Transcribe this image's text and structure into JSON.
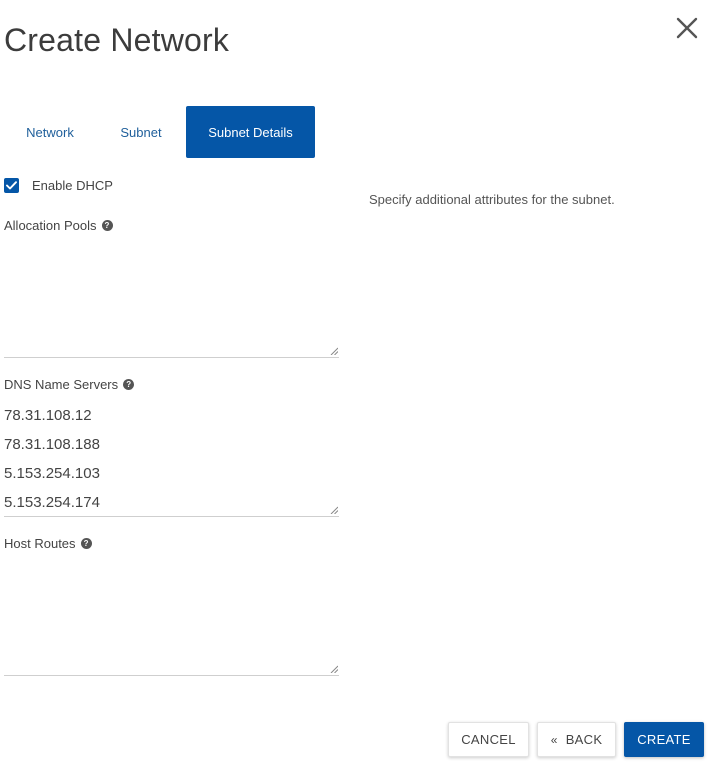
{
  "modal": {
    "title": "Create Network",
    "close_icon": "close-icon"
  },
  "tabs": [
    {
      "label": "Network",
      "active": false
    },
    {
      "label": "Subnet",
      "active": false
    },
    {
      "label": "Subnet Details",
      "active": true
    }
  ],
  "form": {
    "enable_dhcp": {
      "label": "Enable DHCP",
      "checked": true
    },
    "allocation_pools": {
      "label": "Allocation Pools",
      "value": ""
    },
    "dns_name_servers": {
      "label": "DNS Name Servers",
      "values": [
        "78.31.108.12",
        "78.31.108.188",
        "5.153.254.103",
        "5.153.254.174"
      ]
    },
    "host_routes": {
      "label": "Host Routes",
      "value": ""
    },
    "help_icon": "question-circle-icon"
  },
  "help_text": "Specify additional attributes for the subnet.",
  "buttons": {
    "cancel": "CANCEL",
    "back": "BACK",
    "back_icon": "«",
    "create": "CREATE"
  },
  "colors": {
    "primary": "#0556a7",
    "link": "#1f5f9b",
    "title": "#3c3c3c"
  }
}
